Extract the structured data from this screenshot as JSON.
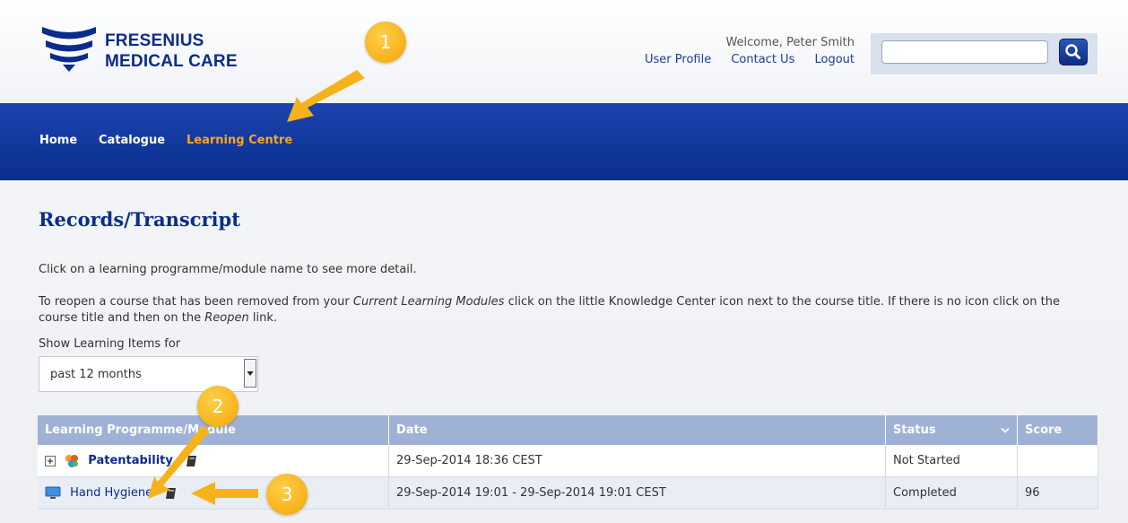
{
  "brand": {
    "line1": "FRESENIUS",
    "line2": "MEDICAL CARE"
  },
  "user": {
    "welcome": "Welcome, Peter Smith"
  },
  "header_links": {
    "profile": "User Profile",
    "contact": "Contact Us",
    "logout": "Logout"
  },
  "search": {
    "value": "",
    "icon": "search-icon"
  },
  "nav": {
    "home": "Home",
    "catalogue": "Catalogue",
    "learning_centre": "Learning Centre"
  },
  "page": {
    "title": "Records/Transcript",
    "intro": "Click on a learning programme/module name to see more detail.",
    "note_part1": "To reopen a course that has been removed from your ",
    "note_em1": "Current Learning Modules",
    "note_part2": " click on the little Knowledge Center icon next to the course title. If there is no icon click on the course title and then on the ",
    "note_em2": "Reopen",
    "note_part3": " link."
  },
  "filter": {
    "label": "Show Learning Items for",
    "selected": "past 12 months"
  },
  "table": {
    "headers": {
      "module": "Learning Programme/Module",
      "date": "Date",
      "status": "Status",
      "score": "Score"
    },
    "rows": [
      {
        "name": "Patentability",
        "date": "29-Sep-2014 18:36 CEST",
        "status": "Not Started",
        "score": ""
      },
      {
        "name": "Hand Hygiene",
        "date": "29-Sep-2014 19:01 - 29-Sep-2014 19:01 CEST",
        "status": "Completed",
        "score": "96"
      }
    ]
  },
  "callouts": {
    "one": "1",
    "two": "2",
    "three": "3"
  },
  "colors": {
    "brand_blue": "#0a2c8c",
    "nav_active": "#f6a623",
    "callout": "#f6b21b",
    "table_header": "#9fb2d6"
  }
}
